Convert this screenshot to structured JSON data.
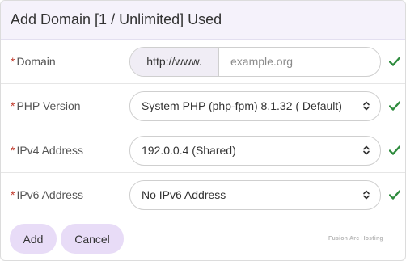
{
  "header": {
    "title": "Add Domain [1 / Unlimited] Used"
  },
  "required_marker": "*",
  "form": {
    "domain": {
      "label": "Domain",
      "prefix": "http://www.",
      "placeholder": "example.org",
      "value": ""
    },
    "php_version": {
      "label": "PHP Version",
      "selected": "System PHP (php-fpm) 8.1.32 ( Default)"
    },
    "ipv4": {
      "label": "IPv4 Address",
      "selected": "192.0.0.4 (Shared)"
    },
    "ipv6": {
      "label": "IPv6 Address",
      "selected": "No IPv6 Address"
    }
  },
  "buttons": {
    "add_label": "Add",
    "cancel_label": "Cancel"
  },
  "branding": {
    "text": "Fusion Arc Hosting"
  },
  "colors": {
    "accent": "#e8dcf7",
    "valid": "#2e8b3d",
    "required": "#c0392b",
    "header_bg": "#f5f2fb"
  },
  "icons": {
    "valid": "check-icon",
    "select": "select-caret-icon"
  }
}
